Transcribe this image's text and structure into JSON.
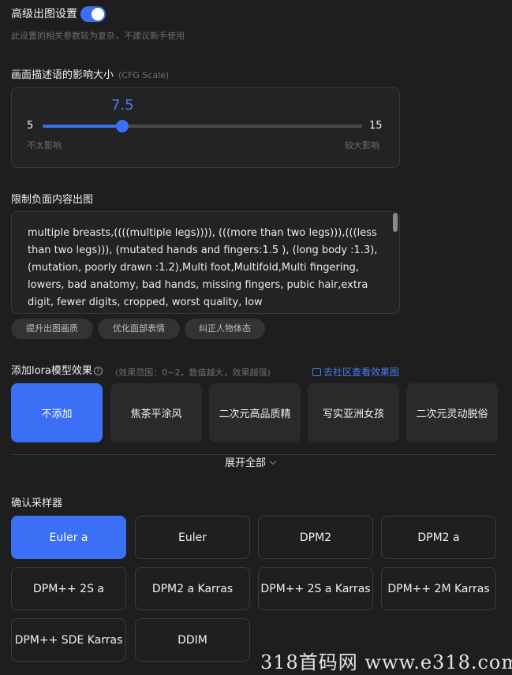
{
  "advanced": {
    "title": "高级出图设置",
    "toggle_on": true,
    "hint": "此设置的相关参数较为复杂，不建议新手使用"
  },
  "cfg": {
    "title": "画面描述语的影响大小",
    "subtitle": "(CFG Scale)",
    "value": "7.5",
    "min": "5",
    "max": "15",
    "left_label": "不太影响",
    "right_label": "较大影响"
  },
  "negative": {
    "title": "限制负面内容出图",
    "text": "multiple breasts,((((multiple legs)))), (((more than two legs))),(((less than two legs))), (mutated hands and fingers:1.5 ), (long body :1.3), (mutation, poorly drawn :1.2),Multi foot,Multifold,Multi fingering, lowers, bad anatomy, bad hands, missing fingers, pubic hair,extra digit, fewer digits, cropped, worst quality, low",
    "chips": [
      "提升出图画质",
      "优化面部表情",
      "纠正人物体态"
    ]
  },
  "lora": {
    "title": "添加lora模型效果",
    "help_icon": "question-circle-icon",
    "hint": "(效果范围：0~2，数值越大，效果越强)",
    "link": "去社区查看效果图",
    "options": [
      "不添加",
      "焦茶平涂风",
      "二次元高品质精",
      "写实亚洲女孩",
      "二次元灵动脱俗"
    ],
    "selected": 0,
    "expand": "展开全部"
  },
  "sampler": {
    "title": "确认采样器",
    "options": [
      "Euler a",
      "Euler",
      "DPM2",
      "DPM2 a",
      "DPM++ 2S a",
      "DPM2 a Karras",
      "DPM++ 2S a Karras",
      "DPM++ 2M Karras",
      "DPM++ SDE Karras",
      "DDIM"
    ],
    "selected": 0
  },
  "watermark": "318首码网 www.e318.com",
  "colors": {
    "accent": "#3b6ff5",
    "link": "#4a7cf6",
    "background": "#1e1e1e"
  }
}
